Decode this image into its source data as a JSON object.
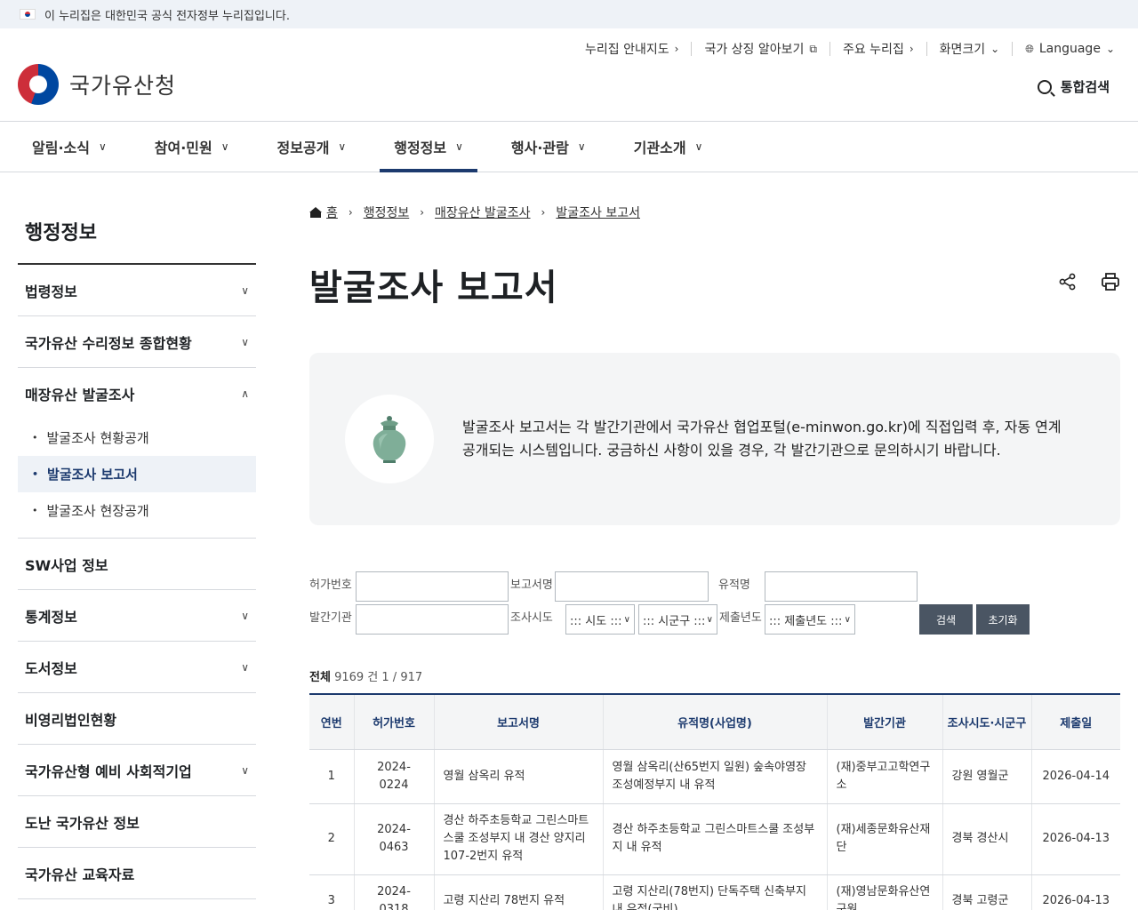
{
  "gov_banner": "이 누리집은 대한민국 공식 전자정부 누리집입니다.",
  "logo_text": "국가유산청",
  "util_nav": [
    "누리집 안내지도",
    "국가 상징 알아보기",
    "주요 누리집",
    "화면크기",
    "Language"
  ],
  "search_all": "통합검색",
  "gnb": [
    "알림·소식",
    "참여·민원",
    "정보공개",
    "행정정보",
    "행사·관람",
    "기관소개"
  ],
  "lnb": {
    "title": "행정정보",
    "items": [
      "법령정보",
      "국가유산 수리정보 종합현황",
      "매장유산 발굴조사",
      "SW사업 정보",
      "통계정보",
      "도서정보",
      "비영리법인현황",
      "국가유산형 예비 사회적기업",
      "도난 국가유산 정보",
      "국가유산 교육자료"
    ],
    "subitems": [
      "발굴조사 현황공개",
      "발굴조사 보고서",
      "발굴조사 현장공개"
    ]
  },
  "breadcrumb": [
    "홈",
    "행정정보",
    "매장유산 발굴조사",
    "발굴조사 보고서"
  ],
  "page_title": "발굴조사 보고서",
  "info_text": "발굴조사 보고서는 각 발간기관에서 국가유산 협업포털(e-minwon.go.kr)에 직접입력 후, 자동 연계 공개되는 시스템입니다. 궁금하신 사항이 있을 경우, 각 발간기관으로 문의하시기 바랍니다.",
  "search": {
    "labels": {
      "permit": "허가번호",
      "report": "보고서명",
      "site": "유적명",
      "publisher": "발간기관",
      "sido": "조사시도",
      "year": "제출년도"
    },
    "selects": {
      "sido": "::: 시도 :::",
      "sigungu": "::: 시군구 :::",
      "year": "::: 제출년도 :::"
    },
    "buttons": {
      "search": "검색",
      "reset": "초기화"
    }
  },
  "total": {
    "label": "전체",
    "count": "9169",
    "unit": "건",
    "page": "1 / 917"
  },
  "table": {
    "headers": [
      "연번",
      "허가번호",
      "보고서명",
      "유적명(사업명)",
      "발간기관",
      "조사시도·시군구",
      "제출일"
    ],
    "rows": [
      [
        "1",
        "2024-0224",
        "영월 삼옥리 유적",
        "영월 삼옥리(산65번지 일원) 숲속야영장 조성예정부지 내 유적",
        "(재)중부고고학연구소",
        "강원 영월군",
        "2026-04-14"
      ],
      [
        "2",
        "2024-0463",
        "경산 하주초등학교 그린스마트스쿨 조성부지 내 경산 양지리 107-2번지 유적",
        "경산 하주초등학교 그린스마트스쿨 조성부지 내 유적",
        "(재)세종문화유산재단",
        "경북 경산시",
        "2026-04-13"
      ],
      [
        "3",
        "2024-0318",
        "고령 지산리 78번지 유적",
        "고령 지산리(78번지) 단독주택 신축부지 내 유적(국비)",
        "(재)영남문화유산연구원",
        "경북 고령군",
        "2026-04-13"
      ]
    ]
  },
  "colors": {
    "primary": "#1c3a6e",
    "banner_bg": "#eef2f7",
    "button": "#4a5563"
  }
}
